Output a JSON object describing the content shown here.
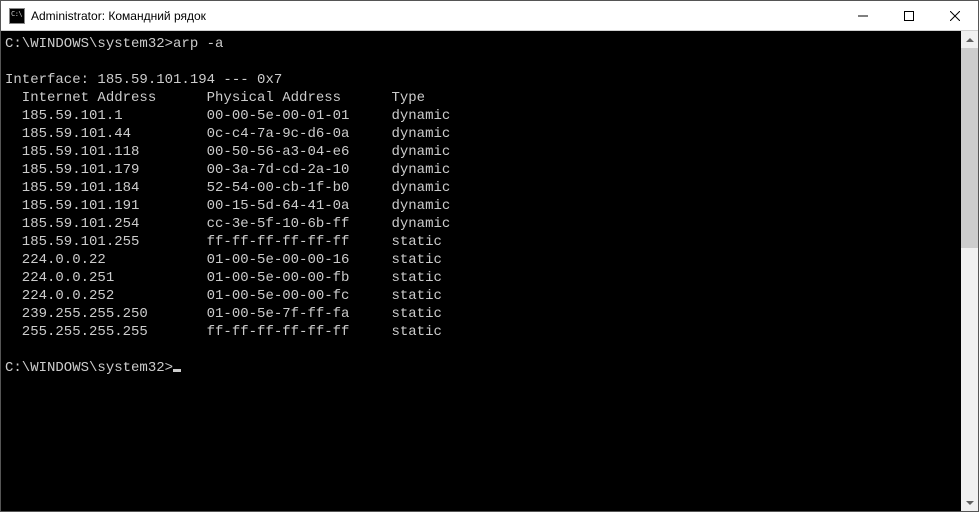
{
  "window": {
    "title": "Administrator: Командний рядок"
  },
  "prompt1": "C:\\WINDOWS\\system32>",
  "command1": "arp -a",
  "blank": "",
  "interface_line": "Interface: 185.59.101.194 --- 0x7",
  "header": {
    "ip": "Internet Address",
    "mac": "Physical Address",
    "type": "Type"
  },
  "rows": [
    {
      "ip": "185.59.101.1",
      "mac": "00-00-5e-00-01-01",
      "type": "dynamic"
    },
    {
      "ip": "185.59.101.44",
      "mac": "0c-c4-7a-9c-d6-0a",
      "type": "dynamic"
    },
    {
      "ip": "185.59.101.118",
      "mac": "00-50-56-a3-04-e6",
      "type": "dynamic"
    },
    {
      "ip": "185.59.101.179",
      "mac": "00-3a-7d-cd-2a-10",
      "type": "dynamic"
    },
    {
      "ip": "185.59.101.184",
      "mac": "52-54-00-cb-1f-b0",
      "type": "dynamic"
    },
    {
      "ip": "185.59.101.191",
      "mac": "00-15-5d-64-41-0a",
      "type": "dynamic"
    },
    {
      "ip": "185.59.101.254",
      "mac": "cc-3e-5f-10-6b-ff",
      "type": "dynamic"
    },
    {
      "ip": "185.59.101.255",
      "mac": "ff-ff-ff-ff-ff-ff",
      "type": "static"
    },
    {
      "ip": "224.0.0.22",
      "mac": "01-00-5e-00-00-16",
      "type": "static"
    },
    {
      "ip": "224.0.0.251",
      "mac": "01-00-5e-00-00-fb",
      "type": "static"
    },
    {
      "ip": "224.0.0.252",
      "mac": "01-00-5e-00-00-fc",
      "type": "static"
    },
    {
      "ip": "239.255.255.250",
      "mac": "01-00-5e-7f-ff-fa",
      "type": "static"
    },
    {
      "ip": "255.255.255.255",
      "mac": "ff-ff-ff-ff-ff-ff",
      "type": "static"
    }
  ],
  "prompt2": "C:\\WINDOWS\\system32>"
}
